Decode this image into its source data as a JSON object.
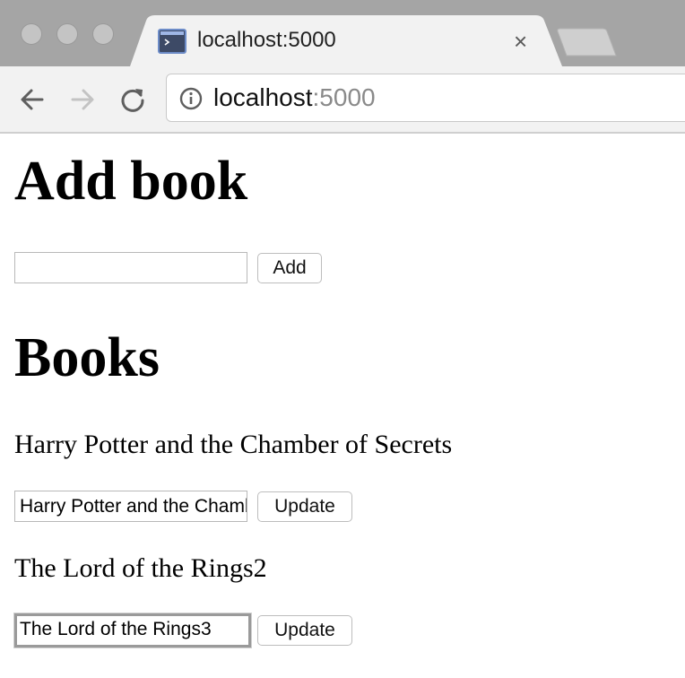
{
  "browser": {
    "tab_title": "localhost:5000",
    "tab_close": "×",
    "url_host": "localhost",
    "url_port": ":5000"
  },
  "page": {
    "add_heading": "Add book",
    "add_input_value": "",
    "add_button": "Add",
    "books_heading": "Books",
    "books": [
      {
        "title": "Harry Potter and the Chamber of Secrets",
        "input_value": "Harry Potter and the Chamber of Secrets",
        "button": "Update"
      },
      {
        "title": "The Lord of the Rings2",
        "input_value": "The Lord of the Rings3",
        "button": "Update"
      }
    ]
  }
}
